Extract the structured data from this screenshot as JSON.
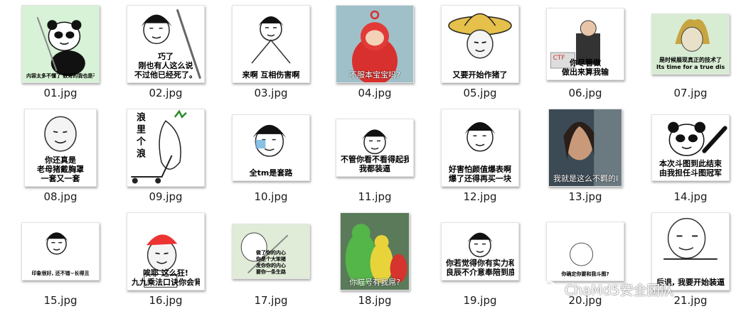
{
  "files": [
    {
      "name": "01.jpg",
      "caption": "内容太多不懂了 教寄的我也是不看不了 这一定要你在学你们",
      "bg": "#d7f2d6",
      "fig": "panda-sword",
      "cap_style": "small"
    },
    {
      "name": "02.jpg",
      "caption": "巧了\n刚也有人这么说\n不过他已经死了。",
      "bg": "#ffffff",
      "fig": "bowl-sword",
      "cap_style": "normal"
    },
    {
      "name": "03.jpg",
      "caption": "来啊 互相伤害啊",
      "bg": "#ffffff",
      "fig": "bowl-cape",
      "cap_style": "normal"
    },
    {
      "name": "04.jpg",
      "caption": "不服本宝宝吗?",
      "bg": "#b7cdd6",
      "fig": "teletubby-red",
      "cap_style": "light"
    },
    {
      "name": "05.jpg",
      "caption": "又要开始作猪了",
      "bg": "#ffffff",
      "fig": "strawhat",
      "cap_style": "normal"
    },
    {
      "name": "06.jpg",
      "caption": "你尽管做\n做出来算我输",
      "bg": "#ffffff",
      "fig": "businessman",
      "cap_style": "normal"
    },
    {
      "name": "07.jpg",
      "caption": "是时候展现真正的技术了\nIts time for a true display of skill",
      "bg": "#d8ecd4",
      "fig": "blondhair",
      "cap_style": "normal"
    },
    {
      "name": "08.jpg",
      "caption": "你还真是\n老母猪戴胸罩\n一套又一套",
      "bg": "#ffffff",
      "fig": "blob-face",
      "cap_style": "normal"
    },
    {
      "name": "09.jpg",
      "caption": "浪里个浪",
      "bg": "#ffffff",
      "fig": "radish-cart",
      "cap_style": "vertical"
    },
    {
      "name": "10.jpg",
      "caption": "全tm是套路",
      "bg": "#ffffff",
      "fig": "bowl-cry",
      "cap_style": "normal"
    },
    {
      "name": "11.jpg",
      "caption": "不管你看不看得起我\n我都装逼",
      "bg": "#ffffff",
      "fig": "bowl-peek",
      "cap_style": "normal"
    },
    {
      "name": "12.jpg",
      "caption": "好害怕颜值爆表啊\n爆了还得再买一块",
      "bg": "#ffffff",
      "fig": "bowl-smug",
      "cap_style": "normal"
    },
    {
      "name": "13.jpg",
      "caption": "我就是这么不羁的BOY",
      "bg": "#4a5a66",
      "fig": "photo-man",
      "cap_style": "light"
    },
    {
      "name": "14.jpg",
      "caption": "本次斗图到此结束\n由我担任斗图冠军",
      "bg": "#ffffff",
      "fig": "panda-point",
      "cap_style": "normal"
    },
    {
      "name": "15.jpg",
      "caption": "印象很好, 还不错~长得丑",
      "bg": "#ffffff",
      "fig": "bowl-sit",
      "cap_style": "small"
    },
    {
      "name": "16.jpg",
      "caption": "唉耶 这么狂!\n九九乘法口诀你会背吗?",
      "bg": "#ffffff",
      "fig": "kid-cap",
      "cap_style": "normal"
    },
    {
      "name": "17.jpg",
      "caption": "做了你的内心\n你是个大笨猪\n发你你的内心\n要你一条生路",
      "bg": "#e0ecd8",
      "fig": "egghead-sword",
      "cap_style": "small"
    },
    {
      "name": "18.jpg",
      "caption": "你瞄号有我屌?",
      "bg": "#6a8a6a",
      "fig": "teletubbies-group",
      "cap_style": "light"
    },
    {
      "name": "19.jpg",
      "caption": "你若觉得你有实力和我玩\n良辰不介意奉陪到底",
      "bg": "#ffffff",
      "fig": "bowl-bed",
      "cap_style": "normal"
    },
    {
      "name": "20.jpg",
      "caption": "你确定你要和我斗图?",
      "bg": "#ffffff",
      "fig": "small-face",
      "cap_style": "small"
    },
    {
      "name": "21.jpg",
      "caption": "后退, 我要开始装逼了",
      "bg": "#ffffff",
      "fig": "egghead-point",
      "cap_style": "normal"
    }
  ],
  "watermark": {
    "text": "ChaMd5安全团队",
    "icon": "wechat-icon"
  }
}
